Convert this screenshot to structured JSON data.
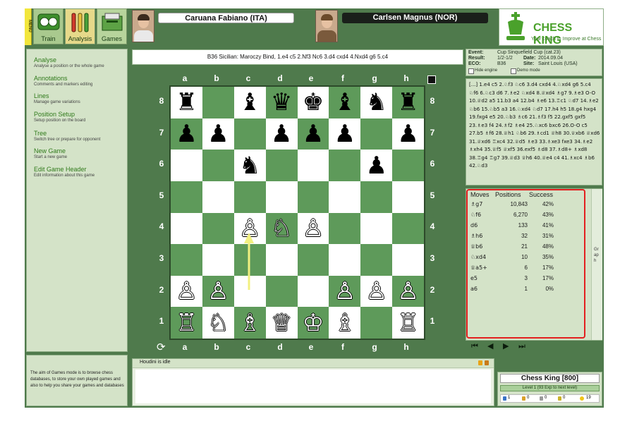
{
  "toolbar": {
    "menu_label": "MENU",
    "train_label": "Train",
    "analysis_label": "Analysis",
    "games_label": "Games"
  },
  "players": {
    "white": "Caruana Fabiano (ITA)",
    "black": "Carlsen Magnus (NOR)"
  },
  "logo": {
    "title": "CHESS KING",
    "tagline": "Your coach to Improve at Chess"
  },
  "sidebar": {
    "items": [
      {
        "title": "Analyse",
        "desc": "Analyse a position or the whole game"
      },
      {
        "title": "Annotations",
        "desc": "Comments and markers editing"
      },
      {
        "title": "Lines",
        "desc": "Manage game variations"
      },
      {
        "title": "Position Setup",
        "desc": "Setup position on the board"
      },
      {
        "title": "Tree",
        "desc": "Switch tree or prepare for opponent"
      },
      {
        "title": "New Game",
        "desc": "Start a new game"
      },
      {
        "title": "Edit Game Header",
        "desc": "Edit information about this game"
      }
    ],
    "help_text": "The aim of Games mode is to browse chess databases, to store your own played games and also to help you share your games and databases"
  },
  "opening_line": "B36 Sicilian: Maroczy Bind, 1.e4 c5 2.Nf3 Nc6 3.d4 cxd4 4.Nxd4 g6 5.c4",
  "board": {
    "files": [
      "a",
      "b",
      "c",
      "d",
      "e",
      "f",
      "g",
      "h"
    ],
    "ranks": [
      "8",
      "7",
      "6",
      "5",
      "4",
      "3",
      "2",
      "1"
    ],
    "rows": [
      [
        "♜",
        "",
        "♝",
        "♛",
        "♚",
        "♝",
        "♞",
        "♜"
      ],
      [
        "♟",
        "♟",
        "",
        "♟",
        "♟",
        "♟",
        "",
        "♟"
      ],
      [
        "",
        "",
        "♞",
        "",
        "",
        "",
        "♟",
        ""
      ],
      [
        "",
        "",
        "",
        "",
        "",
        "",
        "",
        ""
      ],
      [
        "",
        "",
        "♙",
        "♘",
        "♙",
        "",
        "",
        ""
      ],
      [
        "",
        "",
        "",
        "",
        "",
        "",
        "",
        ""
      ],
      [
        "♙",
        "♙",
        "",
        "",
        "",
        "♙",
        "♙",
        "♙"
      ],
      [
        "♖",
        "♘",
        "♗",
        "♕",
        "♔",
        "♗",
        "",
        "♖"
      ]
    ],
    "colors": [
      [
        "b",
        "",
        "b",
        "b",
        "b",
        "b",
        "b",
        "b"
      ],
      [
        "b",
        "b",
        "",
        "b",
        "b",
        "b",
        "",
        "b"
      ],
      [
        "",
        "",
        "b",
        "",
        "",
        "",
        "b",
        ""
      ],
      [
        "",
        "",
        "",
        "",
        "",
        "",
        "",
        ""
      ],
      [
        "",
        "",
        "w",
        "w",
        "w",
        "",
        "",
        ""
      ],
      [
        "",
        "",
        "",
        "",
        "",
        "",
        "",
        ""
      ],
      [
        "w",
        "w",
        "",
        "",
        "",
        "w",
        "w",
        "w"
      ],
      [
        "w",
        "w",
        "w",
        "w",
        "w",
        "w",
        "",
        "w"
      ]
    ],
    "last_move": "c2-c4",
    "light_color": "#ffffff",
    "dark_color": "#5e9a5a"
  },
  "game_info": {
    "event_label": "Event:",
    "event": "Cup Sinquefield Cup (cat.23)",
    "result_label": "Result:",
    "result": "1/2-1/2",
    "date_label": "Date:",
    "date": "2014.09.04",
    "eco_label": "ECO:",
    "eco": "B36",
    "site_label": "Site:",
    "site": "Saint Louis (USA)",
    "hide_engine": "Hide engine",
    "demo_mode": "Demo mode"
  },
  "notation": "[...] 1.e4 c5 2.♘f3 ♘c6 3.d4 cxd4 4.♘xd4 g6 5.c4 ♘f6 6.♘c3 d6 7.♗e2 ♘xd4 8.♕xd4 ♗g7 9.♗e3 O-O 10.♕d2 a5 11.b3 a4 12.b4 ♗e6 13.♖c1 ♘d7 14.♗e2 ♘b6 15.♘b5 a3 16.♘xd4 ♘d7 17.h4 h5 18.g4 hxg4 19.fxg4 e5 20.♘b3 ♗c6 21.♗f3 f5 22.gxf5 gxf5 23.♗e3 f4 24.♗f2 ♗e4 25.♘xc6 bxc6 26.O-O c5 27.b5 ♗f6 28.♕h1 ♘b6 29.♗cd1 ♕h8 30.♕xb6 ♕xd6 31.♕xd6 ♖xc4 32.♕d5 ♗e3 33.♗xe3 fxe3 34.♗e2 ♗xh4 35.♕f5 ♕xf5 36.exf5 ♗d8 37.♗d8+ ♗xd8 38.♖g4 ♖g7 39.♕d3 ♕h6 40.♕e4 c4 41.♗xc4 ♗b6 42.♘d3",
  "moves_table": {
    "headers": [
      "Moves",
      "Positions",
      "Success"
    ],
    "rows": [
      {
        "move": "♗g7",
        "positions": "10,843",
        "success": "42%"
      },
      {
        "move": "♘f6",
        "positions": "6,270",
        "success": "43%"
      },
      {
        "move": "d6",
        "positions": "133",
        "success": "41%"
      },
      {
        "move": "♗h6",
        "positions": "32",
        "success": "31%"
      },
      {
        "move": "♕b6",
        "positions": "21",
        "success": "48%"
      },
      {
        "move": "♘xd4",
        "positions": "10",
        "success": "35%"
      },
      {
        "move": "♕a5+",
        "positions": "6",
        "success": "17%"
      },
      {
        "move": "e5",
        "positions": "3",
        "success": "17%"
      },
      {
        "move": "a6",
        "positions": "1",
        "success": "0%"
      }
    ],
    "graph_label": "Graph"
  },
  "nav": {
    "first": "⏮",
    "prev": "◀",
    "next": "▶",
    "last": "⏭"
  },
  "engine": {
    "status": "Houdini is idle"
  },
  "profile": {
    "name": "Chess King [800]",
    "level": "Level 1 (93 Exp to next level)",
    "stats": [
      "1",
      "0",
      "0",
      "0",
      "19"
    ]
  }
}
